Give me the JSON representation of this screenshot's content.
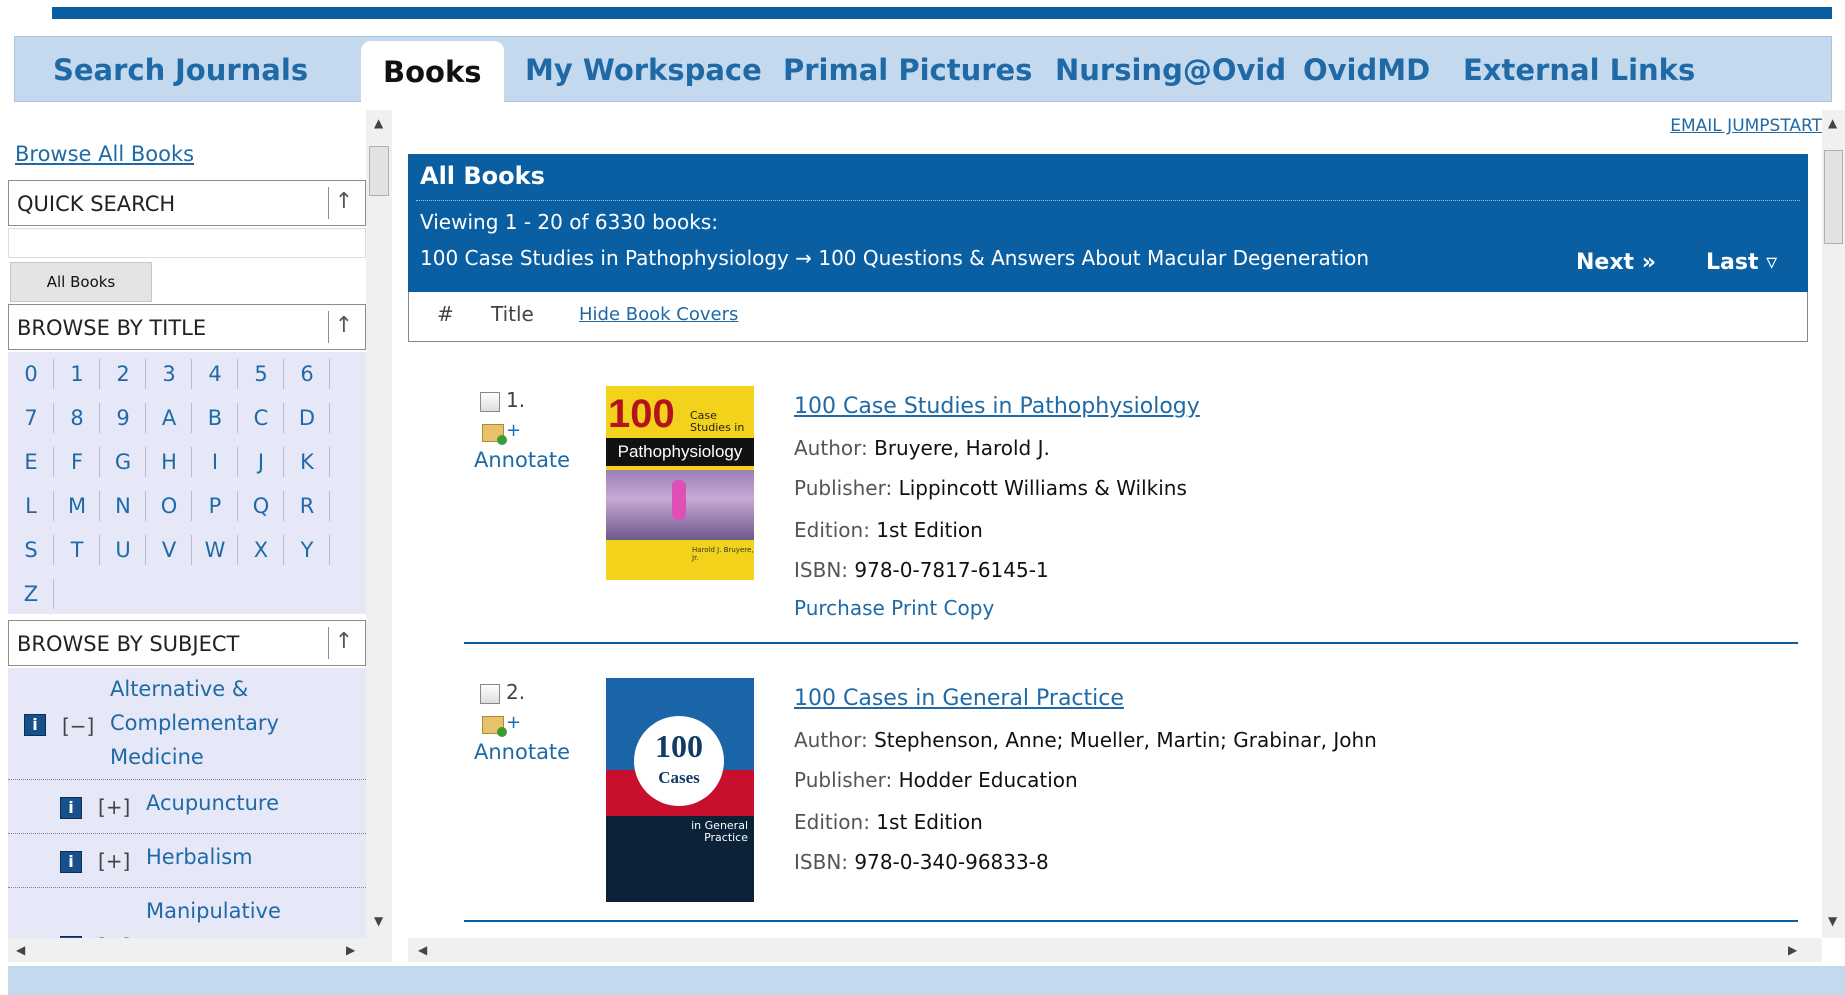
{
  "tabs": [
    {
      "label": "Search"
    },
    {
      "label": "Journals"
    },
    {
      "label": "Books"
    },
    {
      "label": "My Workspace"
    },
    {
      "label": "Primal Pictures"
    },
    {
      "label": "Nursing@Ovid"
    },
    {
      "label": "OvidMD"
    },
    {
      "label": "External Links"
    }
  ],
  "active_tab": "Books",
  "sidebar": {
    "browse_all": "Browse All Books",
    "quick_search": "QUICK SEARCH",
    "quick_search_value": "",
    "all_books_button": "All Books",
    "browse_by_title": "BROWSE BY TITLE",
    "letters": [
      "0",
      "1",
      "2",
      "3",
      "4",
      "5",
      "6",
      "7",
      "8",
      "9",
      "A",
      "B",
      "C",
      "D",
      "E",
      "F",
      "G",
      "H",
      "I",
      "J",
      "K",
      "L",
      "M",
      "N",
      "O",
      "P",
      "Q",
      "R",
      "S",
      "T",
      "U",
      "V",
      "W",
      "X",
      "Y",
      "Z"
    ],
    "browse_by_subject": "BROWSE BY SUBJECT",
    "subjects": [
      {
        "toggle": "[−]",
        "label": "Alternative & Complementary Medicine"
      },
      {
        "toggle": "[+]",
        "label": "Acupuncture"
      },
      {
        "toggle": "[+]",
        "label": "Herbalism"
      },
      {
        "toggle": "[+]",
        "label": "Manipulative"
      }
    ]
  },
  "main": {
    "email_jumpstart": "EMAIL JUMPSTART",
    "header_title": "All Books",
    "viewing": "Viewing 1 - 20 of 6330 books:",
    "range": "100 Case Studies in Pathophysiology  →  100 Questions & Answers About Macular Degeneration",
    "next": "Next »",
    "last": "Last ▿",
    "col_num": "#",
    "col_title": "Title",
    "hide_covers": "Hide Book Covers",
    "annotate_label": "Annotate",
    "annotate_plus": "+",
    "books": [
      {
        "num": "1.",
        "title": "100 Case Studies in Pathophysiology",
        "author_label": "Author:",
        "author": "Bruyere, Harold J.",
        "publisher_label": "Publisher:",
        "publisher": "Lippincott Williams & Wilkins",
        "edition_label": "Edition:",
        "edition": "1st Edition",
        "isbn_label": "ISBN:",
        "isbn": "978-0-7817-6145-1",
        "purchase": "Purchase Print Copy",
        "cover": {
          "big": "100",
          "line1": "Case Studies in",
          "line2": "Pathophysiology",
          "author": "Harold J. Bruyere, Jr."
        }
      },
      {
        "num": "2.",
        "title": "100 Cases in General Practice",
        "author_label": "Author:",
        "author": "Stephenson, Anne; Mueller, Martin; Grabinar, John",
        "publisher_label": "Publisher:",
        "publisher": "Hodder Education",
        "edition_label": "Edition:",
        "edition": "1st Edition",
        "isbn_label": "ISBN:",
        "isbn": "978-0-340-96833-8",
        "cover": {
          "big": "100",
          "line1": "Cases",
          "line2": "in General Practice"
        }
      }
    ]
  },
  "colors": {
    "brand": "#0a5fa3",
    "tab_bar": "#c4d9ee",
    "link": "#1f6aa6",
    "panel": "#e6e8f7"
  }
}
